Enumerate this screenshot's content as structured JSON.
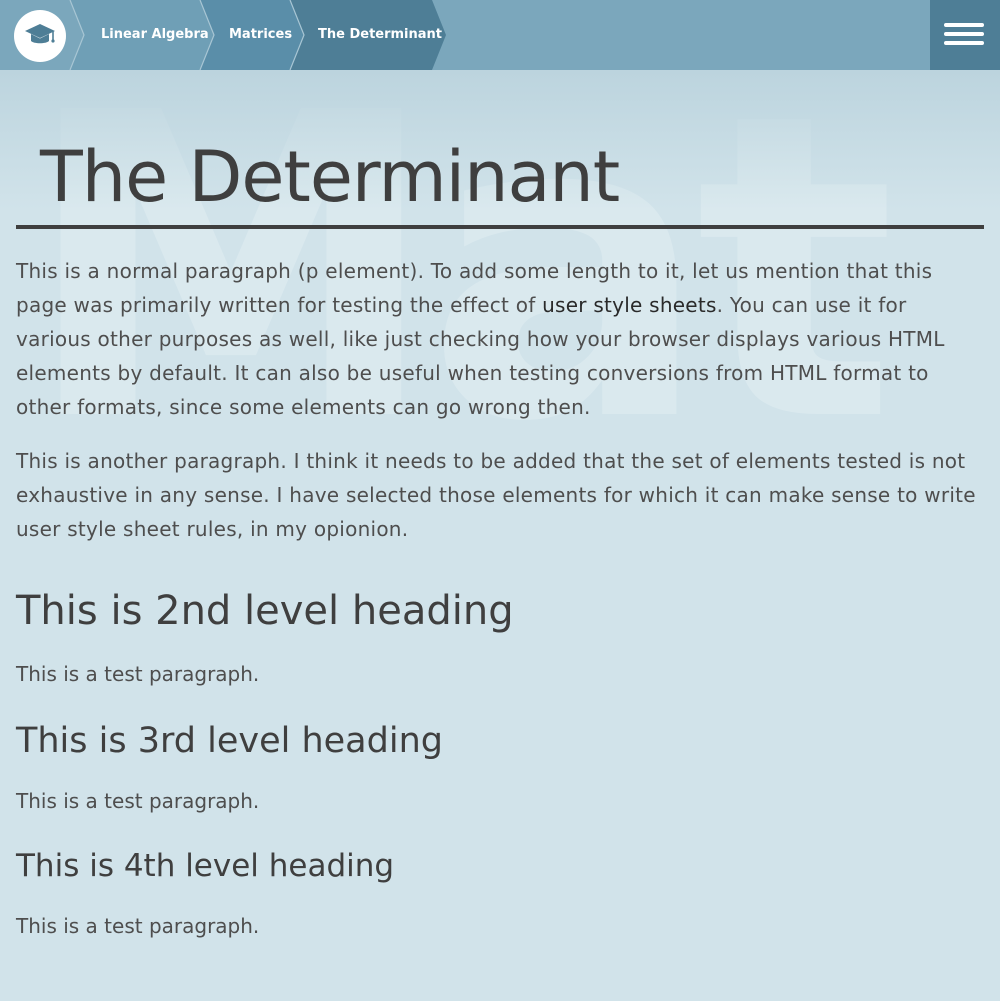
{
  "watermark": "Mat",
  "nav": {
    "breadcrumbs": [
      {
        "label": "Linear Algebra"
      },
      {
        "label": "Matrices"
      },
      {
        "label": "The Determinant"
      }
    ],
    "logo_icon": "graduation-cap-icon",
    "menu_icon": "hamburger-menu-icon",
    "colors": {
      "bar": "#7ba7bc",
      "crumb_1": "#6f9fb6",
      "crumb_2": "#5a8ea9",
      "crumb_3": "#4e7e96",
      "menu_button": "#4e7e96"
    }
  },
  "page": {
    "title": "The Determinant",
    "paragraph_1": {
      "before_link": "This is a normal paragraph (p element). To add some length to it, let us mention that this page was primarily written for testing the effect of ",
      "link_text": "user style sheets",
      "after_link": ". You can use it for various other purposes as well, like just checking how your browser displays various HTML elements by default. It can also be useful when testing conversions from HTML format to other formats, since some elements can go wrong then."
    },
    "paragraph_2": "This is another paragraph. I think it needs to be added that the set of elements tested is not exhaustive in any sense. I have selected those elements for which it can make sense to write user style sheet rules, in my opionion.",
    "h2": "This is 2nd level heading",
    "h2_paragraph": "This is a test paragraph.",
    "h3": "This is 3rd level heading",
    "h3_paragraph": "This is a test paragraph.",
    "h4": "This is 4th level heading",
    "h4_paragraph": "This is a test paragraph."
  },
  "colors": {
    "background": "#d1e3ea",
    "text": "#4e4e4e",
    "heading": "#3f3f3f"
  }
}
